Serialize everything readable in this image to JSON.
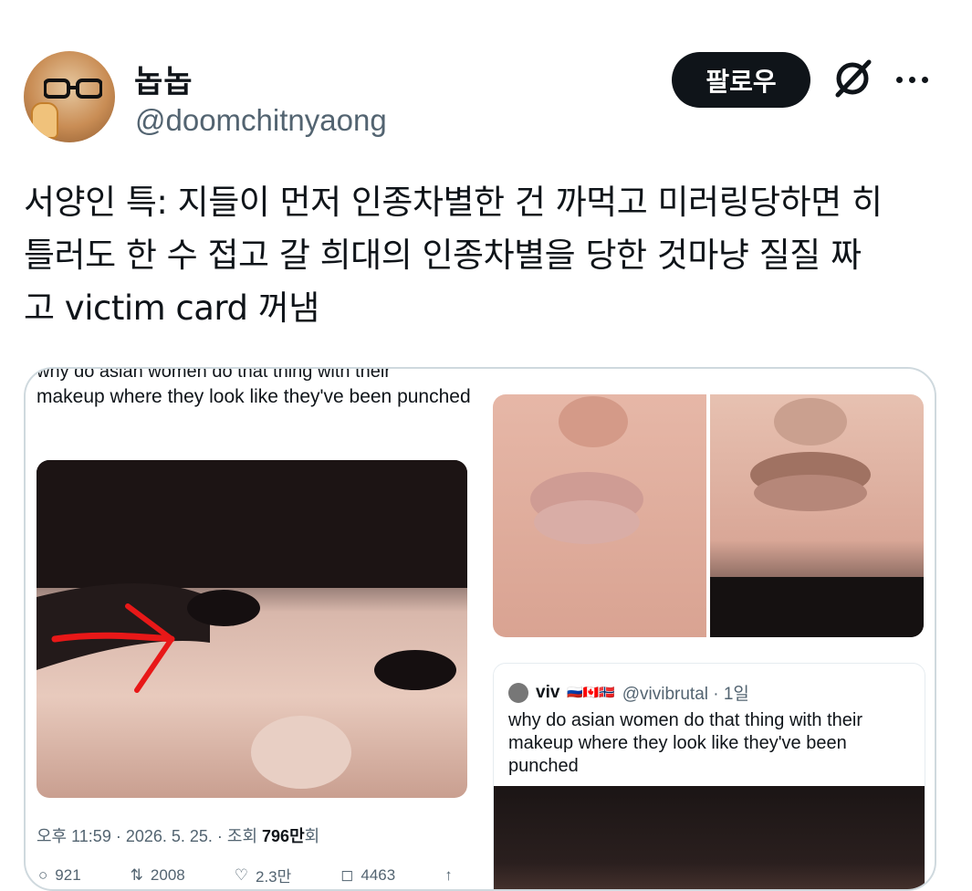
{
  "author": {
    "name": "놉놉",
    "handle": "@doomchitnyaong"
  },
  "header": {
    "follow_label": "팔로우"
  },
  "tweet": {
    "text": "서양인 특: 지들이 먼저 인종차별한 건 까먹고 미러링당하면 히\n틀러도 한 수 접고 갈 희대의 인종차별을 당한 것마냥 질질 짜\n고 victim card 꺼냄"
  },
  "media": {
    "left_top_cut": "why do asian women do that thing with their",
    "left_text": "makeup where they look like they've been punched",
    "meta_time": "오후 11:59 · 2026. 5. 25. · 조회 ",
    "meta_views": "796만",
    "meta_suffix": "회",
    "stats": {
      "replies": "921",
      "retweets": "2008",
      "likes": "2.3만",
      "bookmarks": "4463"
    },
    "quote": {
      "name": "viv",
      "flags": "🇷🇺🇨🇦🇳🇴",
      "handle": "@vivibrutal · 1일",
      "text": "why do asian women do that thing with their makeup where they look like they've been punched"
    }
  }
}
